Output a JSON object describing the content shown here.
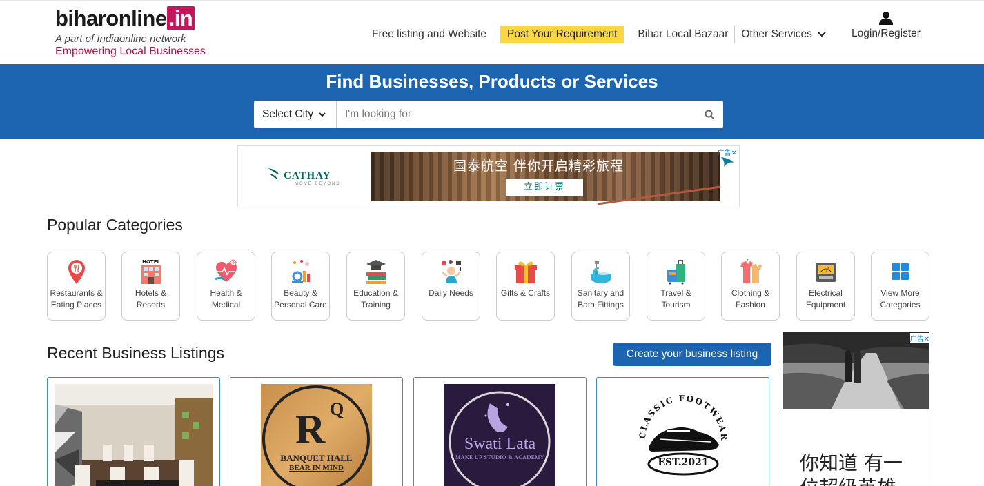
{
  "header": {
    "logo_main": "biharonline",
    "logo_tld": ".in",
    "logo_sub": "A part of Indiaonline network",
    "logo_tagline": "Empowering Local Businesses",
    "nav": {
      "free_listing": "Free listing and Website",
      "post_requirement": "Post Your Requirement",
      "local_bazaar": "Bihar Local Bazaar",
      "other_services": "Other Services",
      "login": "Login/Register"
    }
  },
  "search": {
    "title": "Find Businesses, Products or Services",
    "city_selected": "Select City",
    "placeholder": "I'm looking for"
  },
  "ad_banner": {
    "brand": "CATHAY",
    "brand_sub": "MOVE BEYOND",
    "headline": "国泰航空 伴你开启精彩旅程",
    "cta": "立即订票",
    "badge": "广告✕"
  },
  "popular": {
    "title": "Popular Categories",
    "categories": [
      {
        "label": "Restaurants & Eating Places",
        "icon": "restaurant-pin-icon"
      },
      {
        "label": "Hotels & Resorts",
        "icon": "hotel-icon"
      },
      {
        "label": "Health & Medical",
        "icon": "heart-health-icon"
      },
      {
        "label": "Beauty & Personal Care",
        "icon": "beauty-icon"
      },
      {
        "label": "Education & Training",
        "icon": "graduation-books-icon"
      },
      {
        "label": "Daily Needs",
        "icon": "daily-needs-icon"
      },
      {
        "label": "Gifts & Crafts",
        "icon": "gift-icon"
      },
      {
        "label": "Sanitary and Bath Fittings",
        "icon": "bathtub-icon"
      },
      {
        "label": "Travel & Tourism",
        "icon": "luggage-icon"
      },
      {
        "label": "Clothing & Fashion",
        "icon": "clothing-icon"
      },
      {
        "label": "Electrical Equipment",
        "icon": "electrical-meter-icon"
      },
      {
        "label": "View More Categories",
        "icon": "grid-icon"
      }
    ]
  },
  "listings": {
    "title": "Recent Business Listings",
    "create_button": "Create your business listing",
    "cards": [
      {
        "name": "restaurant-interior"
      },
      {
        "name": "rq-banquet-hall",
        "logo_big": "R",
        "logo_q": "Q",
        "logo_line1": "BANQUET HALL",
        "logo_line2": "BEAR IN MIND"
      },
      {
        "name": "swati-lata",
        "logo_line1": "Swati Lata",
        "logo_line2": "MAKE UP STUDIO & ACADEMY"
      },
      {
        "name": "classic-footwear",
        "logo_arc": "CLASSIC FOOTWEAR",
        "logo_est": "EST.2021"
      }
    ]
  },
  "side_ad": {
    "text": "你知道 有一",
    "text2": "位超级英雄",
    "badge": "广告✕"
  },
  "colors": {
    "brand_blue": "#1c64b0",
    "brand_pink": "#c2185b",
    "post_yellow": "#fad643"
  }
}
